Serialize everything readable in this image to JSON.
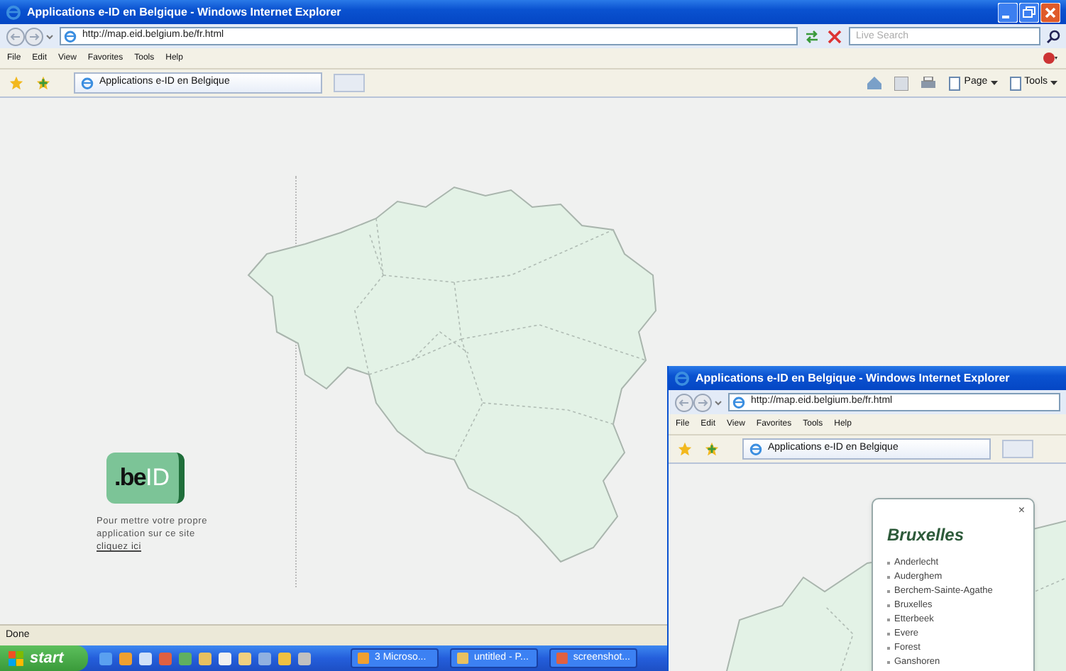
{
  "main_window": {
    "title": "Applications e-ID en Belgique - Windows Internet Explorer",
    "address": "http://map.eid.belgium.be/fr.html",
    "search_placeholder": "Live Search",
    "menu": [
      "File",
      "Edit",
      "View",
      "Favorites",
      "Tools",
      "Help"
    ],
    "tab_title": "Applications e-ID en Belgique",
    "toolbar": [
      "Page",
      "Tools"
    ],
    "status": "Done"
  },
  "page": {
    "logo": {
      "part_1": ".be",
      "part_2": "ID"
    },
    "note": "Pour mettre votre propre application sur ce site ",
    "note_link": "cliquez ici"
  },
  "taskbar": {
    "start": "start",
    "tasks": [
      "3 Microso...",
      "untitled - P...",
      "screenshot..."
    ]
  },
  "second_window": {
    "title": "Applications e-ID en Belgique - Windows Internet Explorer",
    "address": "http://map.eid.belgium.be/fr.html",
    "menu": [
      "File",
      "Edit",
      "View",
      "Favorites",
      "Tools",
      "Help"
    ],
    "tab_title": "Applications e-ID en Belgique"
  },
  "popup": {
    "close": "×",
    "title": "Bruxelles",
    "items": [
      "Anderlecht",
      "Auderghem",
      "Berchem-Sainte-Agathe",
      "Bruxelles",
      "Etterbeek",
      "Evere",
      "Forest",
      "Ganshoren"
    ]
  }
}
